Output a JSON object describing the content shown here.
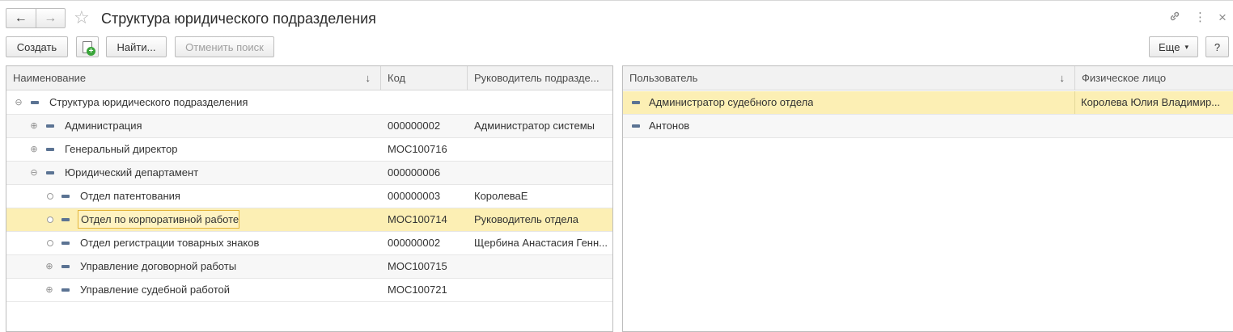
{
  "header": {
    "title": "Структура юридического подразделения",
    "back_icon": "←",
    "forward_icon": "→",
    "star_icon": "☆",
    "link_icon": "🔗",
    "more_icon": "⋮",
    "close_icon": "×"
  },
  "toolbar": {
    "create": "Создать",
    "copy_plus": "+",
    "find": "Найти...",
    "cancel_search": "Отменить поиск",
    "more": "Еще",
    "more_caret": "▾",
    "help": "?"
  },
  "left_table": {
    "columns": {
      "name": "Наименование",
      "name_sort": "↓",
      "code": "Код",
      "manager": "Руководитель подразде..."
    },
    "rows": [
      {
        "toggle": "⊖",
        "name": "Структура юридического подразделения",
        "code": "",
        "manager": ""
      },
      {
        "toggle": "⊕",
        "name": "Администрация",
        "code": "000000002",
        "manager": "Администратор системы"
      },
      {
        "toggle": "⊕",
        "name": "Генеральный директор",
        "code": "МОС100716",
        "manager": ""
      },
      {
        "toggle": "⊖",
        "name": "Юридический департамент",
        "code": "000000006",
        "manager": ""
      },
      {
        "toggle": "",
        "name": "Отдел патентования",
        "code": "000000003",
        "manager": "КоролеваЕ"
      },
      {
        "toggle": "",
        "name": "Отдел по корпоративной работе",
        "code": "МОС100714",
        "manager": "Руководитель отдела"
      },
      {
        "toggle": "",
        "name": "Отдел регистрации товарных знаков",
        "code": "000000002",
        "manager": "Щербина Анастасия Генн..."
      },
      {
        "toggle": "⊕",
        "name": "Управление договорной работы",
        "code": "МОС100715",
        "manager": ""
      },
      {
        "toggle": "⊕",
        "name": "Управление судебной работой",
        "code": "МОС100721",
        "manager": ""
      }
    ]
  },
  "right_table": {
    "columns": {
      "user": "Пользователь",
      "user_sort": "↓",
      "person": "Физическое лицо"
    },
    "rows": [
      {
        "user": "Администратор судебного отдела",
        "person": "Королева Юлия Владимир..."
      },
      {
        "user": "Антонов",
        "person": ""
      }
    ]
  },
  "colors": {
    "selection": "#fcefb4",
    "focus_border": "#e3b53a",
    "header_bg": "#f2f2f2",
    "item_icon": "#5b7393"
  }
}
